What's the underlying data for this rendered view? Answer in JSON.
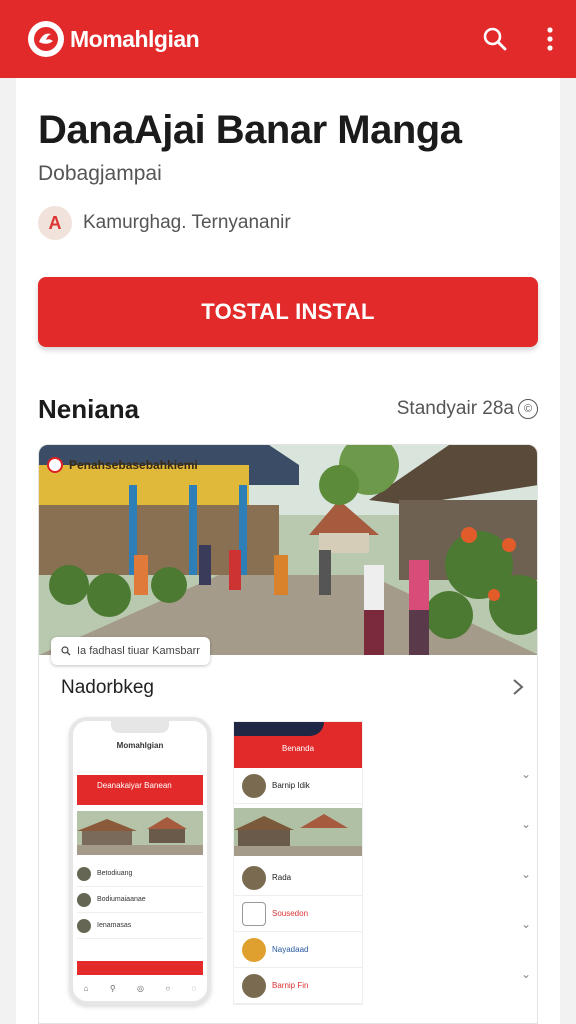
{
  "header": {
    "brand": "Momahlgian",
    "icons": [
      "search-icon",
      "more-vert-icon"
    ],
    "accent": "#e32a2a"
  },
  "app": {
    "title": "DanaAjai Banar Manga",
    "subtitle": "Dobagjampai",
    "developer": "Kamurghag. Ternyananir",
    "developer_initial": "A",
    "install_label": "TOSTAL INSTAL"
  },
  "section": {
    "title": "Neniana",
    "meta": "Standyair 28a",
    "meta_icon": "©"
  },
  "gallery": {
    "banner_text": "Penahsebasebahkiemi",
    "caption": "Ia fadhasl tiuar Kamsbarr",
    "row_label": "Nadorbkeg"
  },
  "phone_mock": {
    "title": "Momahlgian",
    "banner": "Deanakaiyar Banean",
    "items": [
      "Betodiuang",
      "Bodiumaiaanae",
      "Ienamasas"
    ]
  },
  "list_mock": {
    "header": "Benanda",
    "items": [
      "Barnip Idik",
      "Rada",
      "Sousedon",
      "Nayadaad",
      "Barnip Fin"
    ]
  }
}
